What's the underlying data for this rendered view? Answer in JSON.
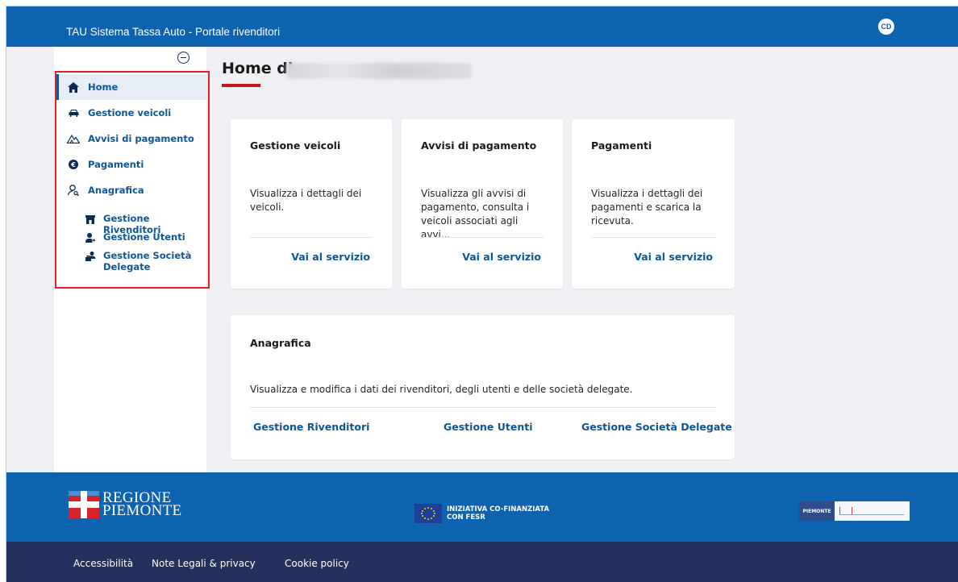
{
  "header": {
    "title": "TAU Sistema Tassa Auto - Portale rivenditori",
    "user_initials": "CD"
  },
  "sidebar": {
    "items": [
      {
        "label": "Home",
        "icon": "home-icon",
        "active": true
      },
      {
        "label": "Gestione veicoli",
        "icon": "car-icon"
      },
      {
        "label": "Avvisi di pagamento",
        "icon": "payment-notice-icon"
      },
      {
        "label": "Pagamenti",
        "icon": "euro-coin-icon"
      },
      {
        "label": "Anagrafica",
        "icon": "user-search-icon"
      }
    ],
    "subitems": [
      {
        "label": "Gestione Rivenditori",
        "icon": "store-icon"
      },
      {
        "label": "Gestione Utenti",
        "icon": "user-add-icon"
      },
      {
        "label": "Gestione Società Delegate",
        "icon": "company-users-icon"
      }
    ]
  },
  "main": {
    "title": "Home di",
    "cards": [
      {
        "title": "Gestione veicoli",
        "description": "Visualizza i dettagli dei veicoli.",
        "link": "Vai al servizio"
      },
      {
        "title": "Avvisi di pagamento",
        "description": "Visualizza gli avvisi di pagamento, consulta i veicoli associati agli avvi...",
        "link": "Vai al servizio"
      },
      {
        "title": "Pagamenti",
        "description": "Visualizza i dettagli dei pagamenti e scarica la ricevuta.",
        "link": "Vai al servizio"
      }
    ],
    "anagrafica": {
      "title": "Anagrafica",
      "description": "Visualizza e modifica i dati dei rivenditori, degli utenti e delle società delegate.",
      "links": [
        "Gestione Rivenditori",
        "Gestione Utenti",
        "Gestione Società Delegate"
      ]
    }
  },
  "footer": {
    "region_line1": "REGIONE",
    "region_line2": "PIEMONTE",
    "eu_line1": "INIZIATIVA CO-FINANZIATA",
    "eu_line2": "CON FESR",
    "links": [
      "Accessibilità",
      "Note Legali & privacy",
      "Cookie policy"
    ]
  },
  "colors": {
    "primary_blue": "#0e63b0",
    "link_blue": "#0d5699",
    "dark_footer": "#24315c",
    "accent_red": "#c2151e",
    "highlight_red": "#e5202c"
  }
}
